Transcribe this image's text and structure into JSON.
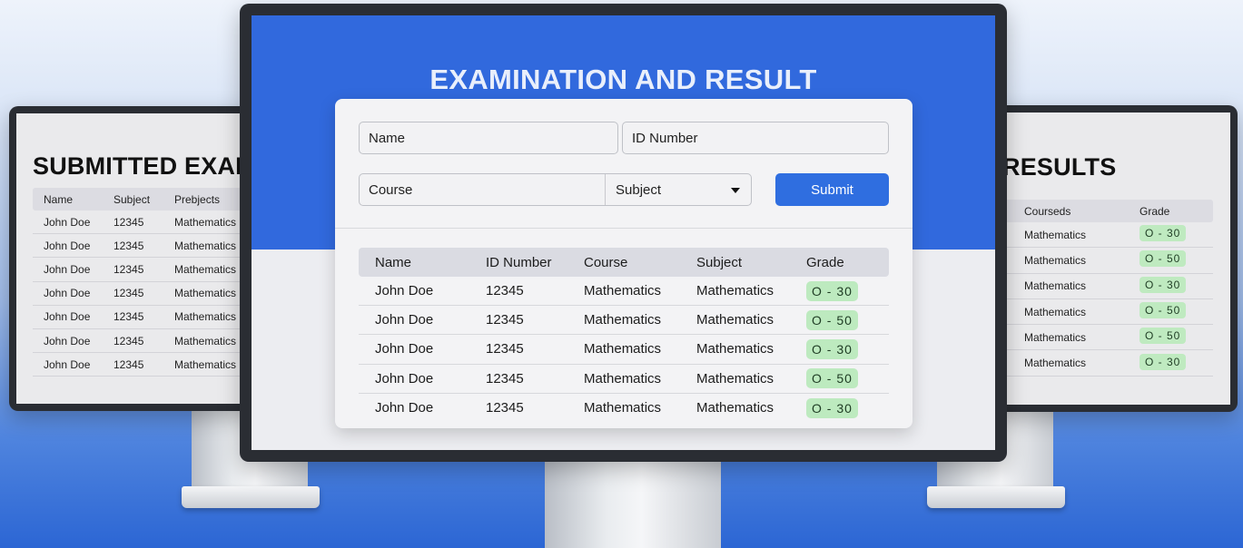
{
  "left_screen": {
    "title": "SUBMITTED EXAM",
    "columns": [
      "Name",
      "Subject",
      "Prebjects"
    ],
    "rows": [
      {
        "name": "John Doe",
        "subject": "12345",
        "prebject": "Mathematics"
      },
      {
        "name": "John Doe",
        "subject": "12345",
        "prebject": "Mathematics"
      },
      {
        "name": "John Doe",
        "subject": "12345",
        "prebject": "Mathematics"
      },
      {
        "name": "John Doe",
        "subject": "12345",
        "prebject": "Mathematics"
      },
      {
        "name": "John Doe",
        "subject": "12345",
        "prebject": "Mathematics"
      },
      {
        "name": "John Doe",
        "subject": "12345",
        "prebject": "Mathematics"
      },
      {
        "name": "John Doe",
        "subject": "12345",
        "prebject": "Mathematics"
      }
    ]
  },
  "right_screen": {
    "title": "RESULTS",
    "columns": [
      "Courseds",
      "Grade"
    ],
    "rows": [
      {
        "course": "Mathematics",
        "grade": "O - 30"
      },
      {
        "course": "Mathematics",
        "grade": "O - 50"
      },
      {
        "course": "Mathematics",
        "grade": "O - 30"
      },
      {
        "course": "Mathematics",
        "grade": "O - 50"
      },
      {
        "course": "Mathematics",
        "grade": "O - 50"
      },
      {
        "course": "Mathematics",
        "grade": "O - 30"
      }
    ]
  },
  "main_screen": {
    "title": "EXAMINATION AND RESULT",
    "form": {
      "name_placeholder": "Name",
      "id_placeholder": "ID Number",
      "course_placeholder": "Course",
      "subject_select": "Subject",
      "submit_label": "Submit"
    },
    "table": {
      "columns": [
        "Name",
        "ID Number",
        "Course",
        "Subject",
        "Grade"
      ],
      "rows": [
        {
          "name": "John Doe",
          "id": "12345",
          "course": "Mathematics",
          "subject": "Mathematics",
          "grade": "O - 30"
        },
        {
          "name": "John Doe",
          "id": "12345",
          "course": "Mathematics",
          "subject": "Mathematics",
          "grade": "O - 50"
        },
        {
          "name": "John Doe",
          "id": "12345",
          "course": "Mathematics",
          "subject": "Mathematics",
          "grade": "O - 30"
        },
        {
          "name": "John Doe",
          "id": "12345",
          "course": "Mathematics",
          "subject": "Mathematics",
          "grade": "O - 50"
        },
        {
          "name": "John Doe",
          "id": "12345",
          "course": "Mathematics",
          "subject": "Mathematics",
          "grade": "O - 30"
        }
      ]
    }
  },
  "colors": {
    "accent_blue": "#3169dd",
    "button_blue": "#2f6ee0",
    "grade_pill": "#bdeabf"
  }
}
